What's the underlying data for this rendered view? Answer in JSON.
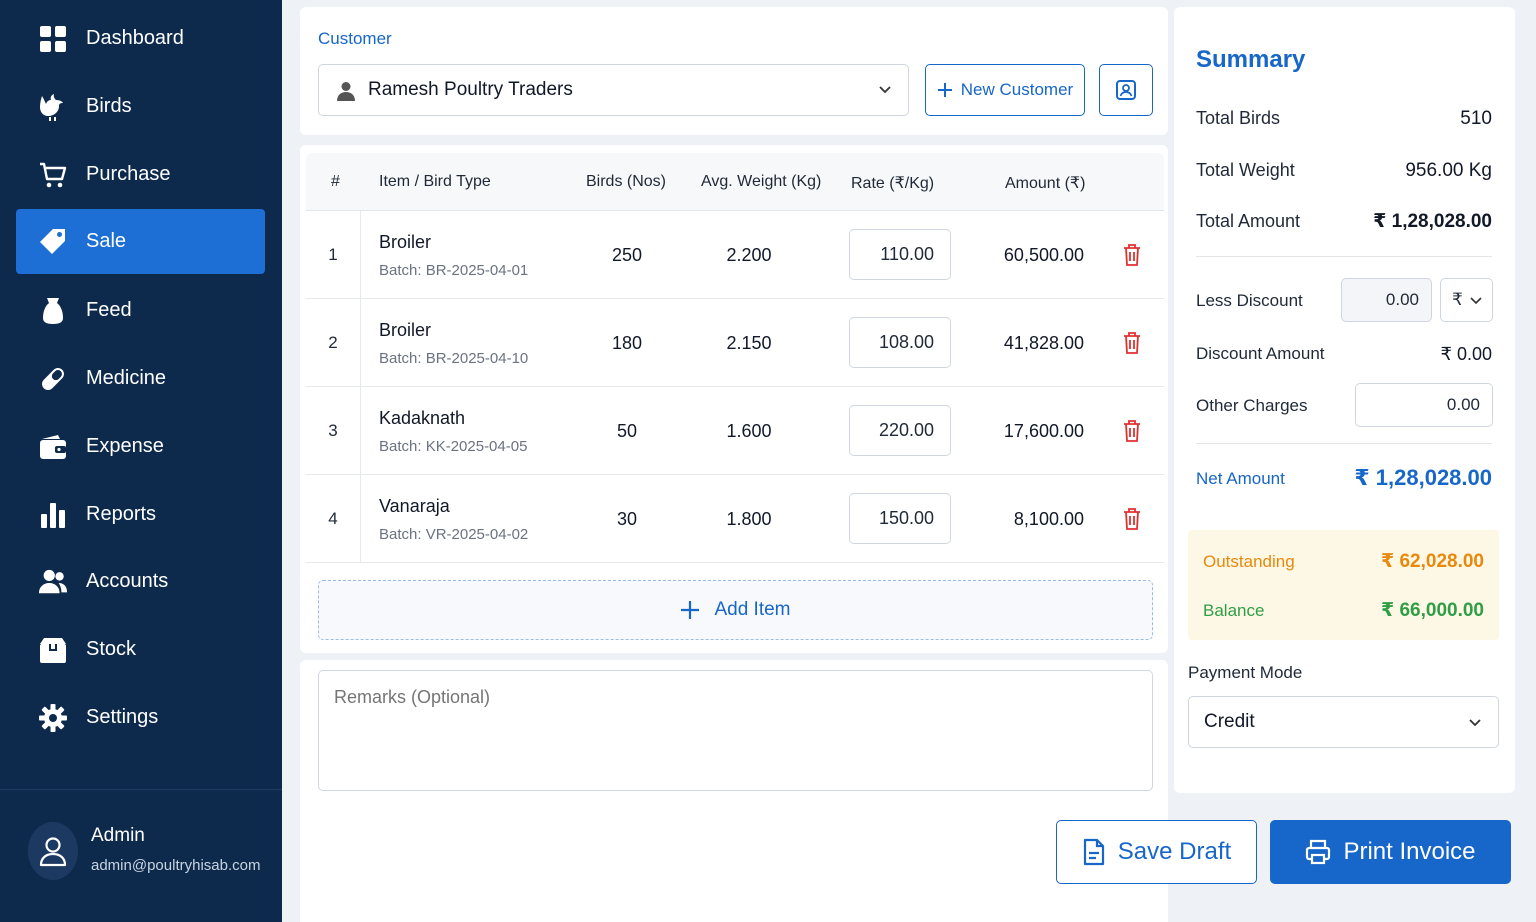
{
  "sidebar": {
    "items": [
      {
        "label": "Dashboard",
        "icon": "grid-icon"
      },
      {
        "label": "Birds",
        "icon": "bird-icon"
      },
      {
        "label": "Purchase",
        "icon": "cart-icon"
      },
      {
        "label": "Sale",
        "icon": "tag-icon",
        "active": true
      },
      {
        "label": "Feed",
        "icon": "feed-sack-icon"
      },
      {
        "label": "Medicine",
        "icon": "pill-icon"
      },
      {
        "label": "Expense",
        "icon": "wallet-icon"
      },
      {
        "label": "Reports",
        "icon": "bar-chart-icon"
      },
      {
        "label": "Accounts",
        "icon": "users-icon"
      },
      {
        "label": "Stock",
        "icon": "box-icon"
      },
      {
        "label": "Settings",
        "icon": "gear-icon"
      }
    ],
    "user": {
      "name": "Admin",
      "email": "admin@poultryhisab.com"
    }
  },
  "customer": {
    "label": "Customer",
    "selected": "Ramesh Poultry Traders",
    "new_customer_label": "New Customer"
  },
  "table": {
    "headers": {
      "num": "#",
      "item": "Item / Bird Type",
      "birds": "Birds (Nos)",
      "weight": "Avg. Weight (Kg)",
      "rate": "Rate (₹/Kg)",
      "amount": "Amount (₹)"
    },
    "rows": [
      {
        "num": "1",
        "name": "Broiler",
        "batch": "Batch: BR-2025-04-01",
        "birds": "250",
        "weight": "2.200",
        "rate": "110.00",
        "amount": "60,500.00"
      },
      {
        "num": "2",
        "name": "Broiler",
        "batch": "Batch: BR-2025-04-10",
        "birds": "180",
        "weight": "2.150",
        "rate": "108.00",
        "amount": "41,828.00"
      },
      {
        "num": "3",
        "name": "Kadaknath",
        "batch": "Batch: KK-2025-04-05",
        "birds": "50",
        "weight": "1.600",
        "rate": "220.00",
        "amount": "17,600.00"
      },
      {
        "num": "4",
        "name": "Vanaraja",
        "batch": "Batch: VR-2025-04-02",
        "birds": "30",
        "weight": "1.800",
        "rate": "150.00",
        "amount": "8,100.00"
      }
    ],
    "add_item_label": "Add Item"
  },
  "remarks": {
    "placeholder": "Remarks (Optional)"
  },
  "summary": {
    "title": "Summary",
    "total_birds_label": "Total Birds",
    "total_birds": "510",
    "total_weight_label": "Total Weight",
    "total_weight": "956.00 Kg",
    "total_amount_label": "Total Amount",
    "total_amount": "₹ 1,28,028.00",
    "less_discount_label": "Less Discount",
    "less_discount_value": "0.00",
    "discount_unit": "₹",
    "discount_amount_label": "Discount Amount",
    "discount_amount": "₹ 0.00",
    "other_charges_label": "Other Charges",
    "other_charges_value": "0.00",
    "net_amount_label": "Net Amount",
    "net_amount": "₹ 1,28,028.00",
    "outstanding_label": "Outstanding",
    "outstanding": "₹ 62,028.00",
    "balance_label": "Balance",
    "balance": "₹ 66,000.00",
    "payment_mode_label": "Payment Mode",
    "payment_mode": "Credit"
  },
  "actions": {
    "save_draft": "Save Draft",
    "print_invoice": "Print Invoice"
  },
  "colors": {
    "primary": "#1766c9",
    "sidebar_bg": "#0d2a4d",
    "danger": "#e03131",
    "warning": "#e8890c",
    "success": "#2f9e44"
  }
}
